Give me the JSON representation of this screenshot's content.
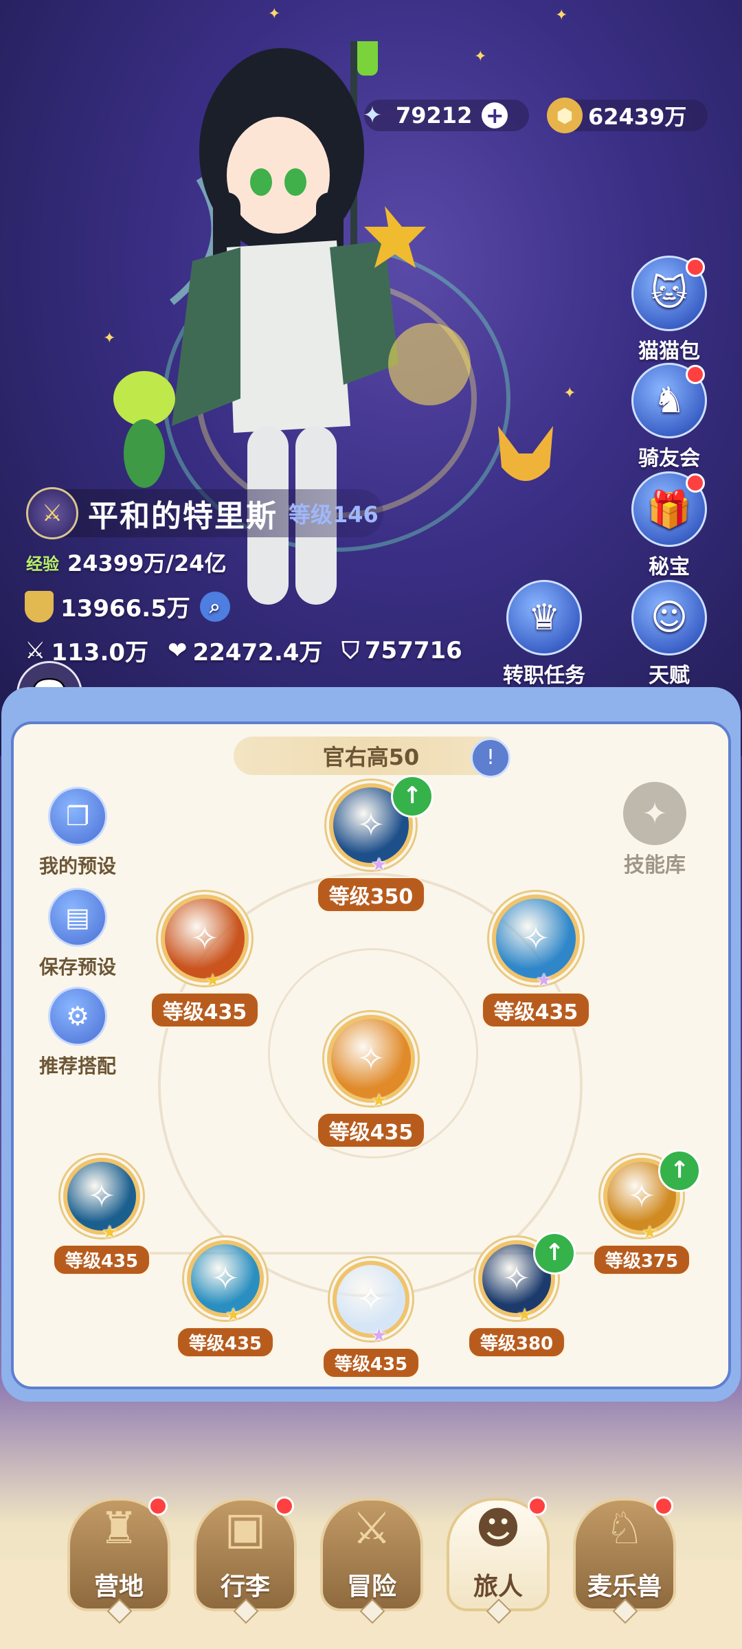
{
  "currency": {
    "diamond_value": "79212",
    "diamond_icon": "crystal-star-icon",
    "plus_label": "+",
    "gold_value": "62439万",
    "gold_icon": "gold-coin-icon"
  },
  "right_menu": [
    {
      "label": "猫猫包",
      "icon": "cat-bag-icon",
      "badge": true
    },
    {
      "label": "骑友会",
      "icon": "horse-icon",
      "badge": true
    },
    {
      "label": "秘宝",
      "icon": "treasure-icon",
      "badge": true
    },
    {
      "label": "天赋",
      "icon": "brain-head-icon",
      "badge": false
    }
  ],
  "job_quest": {
    "label": "转职任务",
    "icon": "crown-icon"
  },
  "player": {
    "name": "平和的特里斯",
    "level_label": "等级146",
    "exp_label": "经验",
    "exp_value": "24399万/24亿",
    "power_value": "13966.5万",
    "attack_value": "113.0万",
    "hp_value": "22472.4万",
    "defense_value": "757716"
  },
  "panel": {
    "title": "官右高50",
    "left_buttons": [
      {
        "label": "我的预设",
        "icon": "preset-cards-icon"
      },
      {
        "label": "保存预设",
        "icon": "save-disk-icon"
      },
      {
        "label": "推荐搭配",
        "icon": "recommend-combo-icon"
      }
    ],
    "skill_library_label": "技能库"
  },
  "skills": [
    {
      "id": "top",
      "level": "等级350",
      "stars": 5,
      "star_color": "purple",
      "upgrade": true,
      "color": "#1d4f8a"
    },
    {
      "id": "left",
      "level": "等级435",
      "stars": 1,
      "star_color": "gold",
      "upgrade": false,
      "color": "#c9541e"
    },
    {
      "id": "right",
      "level": "等级435",
      "stars": 3,
      "star_color": "purple",
      "upgrade": false,
      "color": "#2f87c9"
    },
    {
      "id": "center",
      "level": "等级435",
      "stars": 2,
      "star_color": "gold",
      "upgrade": false,
      "color": "#e08a2a"
    },
    {
      "id": "b1",
      "level": "等级435",
      "stars": 3,
      "star_color": "gold",
      "upgrade": false,
      "color": "#1b5f8f"
    },
    {
      "id": "b2",
      "level": "等级435",
      "stars": 3,
      "star_color": "gold",
      "upgrade": false,
      "color": "#2a8fc0"
    },
    {
      "id": "b3",
      "level": "等级435",
      "stars": 4,
      "star_color": "purple",
      "upgrade": false,
      "color": "#d6e6f7"
    },
    {
      "id": "b4",
      "level": "等级380",
      "stars": 1,
      "star_color": "gold",
      "upgrade": true,
      "color": "#1c3b6c"
    },
    {
      "id": "b5",
      "level": "等级375",
      "stars": 2,
      "star_color": "gold",
      "upgrade": true,
      "color": "#d08a22"
    }
  ],
  "bottom_nav": [
    {
      "label": "营地",
      "icon": "castle-icon",
      "badge": true,
      "active": false
    },
    {
      "label": "行李",
      "icon": "backpack-icon",
      "badge": true,
      "active": false
    },
    {
      "label": "冒险",
      "icon": "crossed-swords-icon",
      "badge": false,
      "active": false
    },
    {
      "label": "旅人",
      "icon": "traveler-avatar-icon",
      "badge": true,
      "active": true
    },
    {
      "label": "麦乐兽",
      "icon": "fox-pet-icon",
      "badge": true,
      "active": false
    }
  ]
}
